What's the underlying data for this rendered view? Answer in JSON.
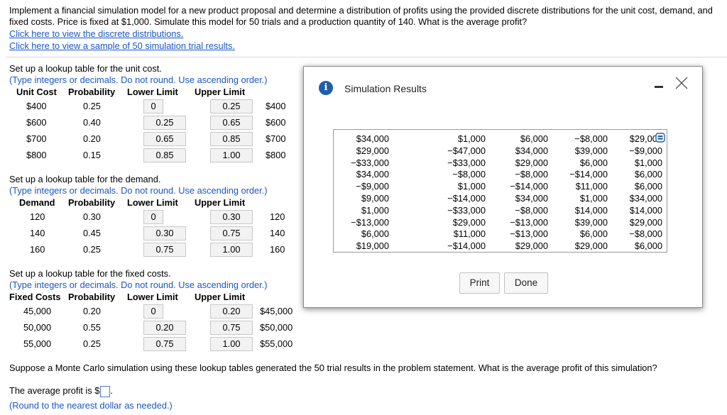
{
  "problem": {
    "text": "Implement a financial simulation model for a new product proposal and determine a distribution of profits using the provided discrete distributions for the unit cost, demand, and fixed costs. Price is fixed at $1,000. Simulate this model for 50 trials and a production quantity of 140. What is the average profit?",
    "link_distributions": "Click here to view the discrete distributions.",
    "link_results": "Click here to view a sample of 50 simulation trial results."
  },
  "unit_cost": {
    "title": "Set up a lookup table for the unit cost.",
    "hint": "(Type integers or decimals. Do not round. Use ascending order.)",
    "headers": [
      "Unit Cost",
      "Probability",
      "Lower Limit",
      "Upper Limit"
    ],
    "rows": [
      {
        "value": "$400",
        "prob": "0.25",
        "lower": "0",
        "upper": "0.25",
        "result": "$400"
      },
      {
        "value": "$600",
        "prob": "0.40",
        "lower": "0.25",
        "upper": "0.65",
        "result": "$600"
      },
      {
        "value": "$700",
        "prob": "0.20",
        "lower": "0.65",
        "upper": "0.85",
        "result": "$700"
      },
      {
        "value": "$800",
        "prob": "0.15",
        "lower": "0.85",
        "upper": "1.00",
        "result": "$800"
      }
    ]
  },
  "demand": {
    "title": "Set up a lookup table for the demand.",
    "hint": "(Type integers or decimals. Do not round. Use ascending order.)",
    "headers": [
      "Demand",
      "Probability",
      "Lower Limit",
      "Upper Limit"
    ],
    "rows": [
      {
        "value": "120",
        "prob": "0.30",
        "lower": "0",
        "upper": "0.30",
        "result": "120"
      },
      {
        "value": "140",
        "prob": "0.45",
        "lower": "0.30",
        "upper": "0.75",
        "result": "140"
      },
      {
        "value": "160",
        "prob": "0.25",
        "lower": "0.75",
        "upper": "1.00",
        "result": "160"
      }
    ]
  },
  "fixed_costs": {
    "title": "Set up a lookup table for the fixed costs.",
    "hint": "(Type integers or decimals. Do not round. Use ascending order.)",
    "headers": [
      "Fixed Costs",
      "Probability",
      "Lower Limit",
      "Upper Limit"
    ],
    "rows": [
      {
        "value": "45,000",
        "prob": "0.20",
        "lower": "0",
        "upper": "0.20",
        "result": "$45,000"
      },
      {
        "value": "50,000",
        "prob": "0.55",
        "lower": "0.20",
        "upper": "0.75",
        "result": "$50,000"
      },
      {
        "value": "55,000",
        "prob": "0.25",
        "lower": "0.75",
        "upper": "1.00",
        "result": "$55,000"
      }
    ]
  },
  "question": "Suppose a Monte Carlo simulation using these lookup tables generated the 50 trial results in the problem statement. What is the average profit of this simulation?",
  "answer": {
    "prefix": "The average profit is $",
    "suffix": ".",
    "note": "(Round to the nearest dollar as needed.)"
  },
  "modal": {
    "info_glyph": "i",
    "title": "Simulation Results",
    "columns": [
      [
        "$34,000",
        "$29,000",
        "−$33,000",
        "$34,000",
        "−$9,000",
        "$9,000",
        "$1,000",
        "−$13,000",
        "$6,000",
        "$19,000"
      ],
      [
        "$1,000",
        "−$47,000",
        "−$33,000",
        "−$8,000",
        "$1,000",
        "−$14,000",
        "−$33,000",
        "$29,000",
        "$11,000",
        "−$14,000"
      ],
      [
        "$6,000",
        "$34,000",
        "$29,000",
        "−$8,000",
        "−$14,000",
        "$34,000",
        "−$8,000",
        "−$13,000",
        "−$13,000",
        "$29,000"
      ],
      [
        "−$8,000",
        "$39,000",
        "$6,000",
        "−$14,000",
        "$11,000",
        "$1,000",
        "$14,000",
        "$39,000",
        "$6,000",
        "$29,000"
      ],
      [
        "$29,000",
        "−$9,000",
        "$1,000",
        "$6,000",
        "$6,000",
        "$34,000",
        "$14,000",
        "$29,000",
        "−$8,000",
        "$6,000"
      ]
    ],
    "print_label": "Print",
    "done_label": "Done"
  }
}
